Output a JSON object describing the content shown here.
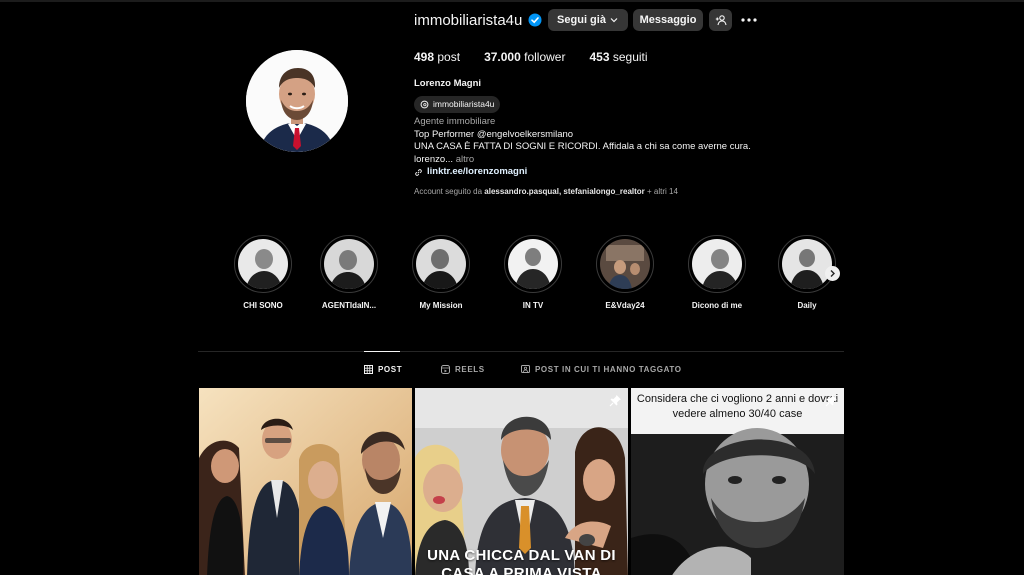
{
  "profile": {
    "username": "immobiliarista4u",
    "follow_button": "Segui già",
    "message_button": "Messaggio",
    "stats": {
      "posts_count": "498",
      "posts_label": "post",
      "followers_count": "37.000",
      "followers_label": "follower",
      "following_count": "453",
      "following_label": "seguiti"
    },
    "full_name": "Lorenzo Magni",
    "threads_handle": "immobiliarista4u",
    "category": "Agente immobiliare",
    "bio_line_1": "Top Performer @engelvoelkersmilano",
    "bio_line_2": "UNA CASA È FATTA DI SOGNI E RICORDI. Affidala a chi sa come averne cura.",
    "bio_line_3": "lorenzo...",
    "bio_more": "altro",
    "link": "linktr.ee/lorenzomagni",
    "followed_by_prefix": "Account seguito da",
    "followed_by_users": "alessandro.pasqual, stefanialongo_realtor",
    "followed_by_suffix": "+ altri 14"
  },
  "highlights": [
    {
      "label": "CHI SONO"
    },
    {
      "label": "AGENTIdaIN..."
    },
    {
      "label": "My Mission"
    },
    {
      "label": "IN TV"
    },
    {
      "label": "E&Vday24"
    },
    {
      "label": "Dicono di me"
    },
    {
      "label": "Daily"
    }
  ],
  "tabs": [
    {
      "label": "POST",
      "active": true
    },
    {
      "label": "REELS",
      "active": false
    },
    {
      "label": "POST IN CUI TI HANNO TAGGATO",
      "active": false
    }
  ],
  "posts": [
    {
      "caption": ""
    },
    {
      "caption": "UNA CHICCA DAL VAN DI CASA A PRIMA VISTA"
    },
    {
      "caption": "Considera che ci vogliono 2 anni e dovrai vedere almeno 30/40 case"
    }
  ],
  "icons": {
    "verified": "verified-badge-icon",
    "chevron": "chevron-down-icon",
    "add_user": "add-user-icon",
    "more": "more-options-icon",
    "threads": "threads-icon",
    "link": "link-icon",
    "grid": "grid-icon",
    "reels": "reels-icon",
    "tagged": "tagged-icon",
    "pin": "pin-icon",
    "next": "chevron-right-icon"
  },
  "colors": {
    "background": "#000000",
    "button": "#363636",
    "verified": "#0095f6",
    "secondary_text": "#a8a8a8"
  }
}
